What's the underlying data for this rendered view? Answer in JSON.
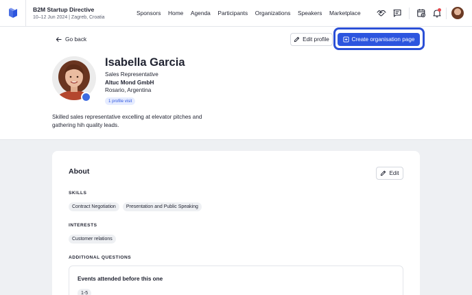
{
  "header": {
    "event_title": "B2M Startup Directive",
    "event_subtitle": "10–12 Jun 2024 | Zagreb, Croatia",
    "nav": [
      "Sponsors",
      "Home",
      "Agenda",
      "Participants",
      "Organizations",
      "Speakers",
      "Marketplace"
    ],
    "icons": [
      "handshake-icon",
      "chat-icon",
      "calendar-add-icon",
      "bell-icon"
    ],
    "colors": {
      "accent": "#2c55df",
      "notification": "#e5484d"
    }
  },
  "profile": {
    "go_back": "Go back",
    "edit_profile": "Edit profile",
    "create_org": "Create organisation page",
    "name": "Isabella Garcia",
    "role": "Sales Representative",
    "company": "Altuc Mond GmbH",
    "location": "Rosario, Argentina",
    "visits": "1 profile visit",
    "bio": "Skilled sales representative excelling at elevator pitches and gathering hih quality leads."
  },
  "about": {
    "title": "About",
    "edit": "Edit",
    "skills_label": "SKILLS",
    "skills": [
      "Contract Negotiation",
      "Presentation and Public Speaking"
    ],
    "interests_label": "INTERESTS",
    "interests": [
      "Customer relations"
    ],
    "additional_label": "ADDITIONAL QUESTIONS",
    "question": "Events attended before this one",
    "answer": "1-5"
  }
}
